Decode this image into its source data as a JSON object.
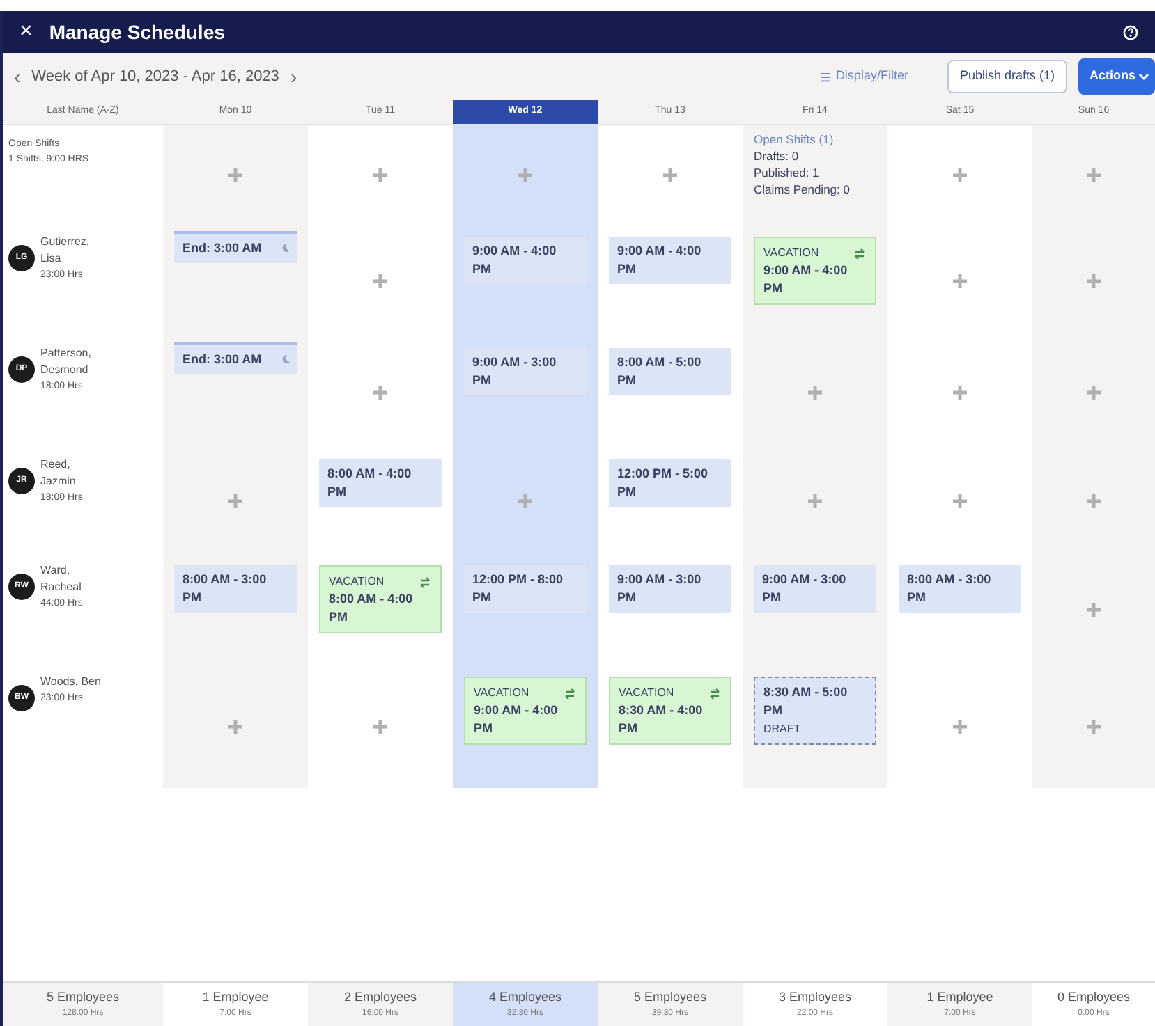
{
  "window": {
    "title": "Manage Schedules",
    "close": "×"
  },
  "toolbar": {
    "prev": "‹",
    "week": "Week of Apr 10, 2023 - Apr 16, 2023",
    "next": "›",
    "display_filter": "Display/Filter",
    "publish": "Publish drafts (1)",
    "actions": "Actions"
  },
  "name_column": "Last Name (A-Z)",
  "days": [
    {
      "label": "Mon 10",
      "selected": false
    },
    {
      "label": "Tue 11",
      "selected": false
    },
    {
      "label": "Wed 12",
      "selected": true
    },
    {
      "label": "Thu 13",
      "selected": false
    },
    {
      "label": "Fri 14",
      "selected": false
    },
    {
      "label": "Sat 15",
      "selected": false
    },
    {
      "label": "Sun 16",
      "selected": false
    }
  ],
  "open_shifts": {
    "title": "Open Shifts",
    "summary": "1 Shifts, 9:00 HRS",
    "cells": [
      {
        "kind": "add"
      },
      {
        "kind": "add"
      },
      {
        "kind": "add"
      },
      {
        "kind": "add"
      },
      {
        "kind": "summary",
        "title": "Open Shifts (1)",
        "lines": [
          "Drafts: 0",
          "Published: 1",
          "Claims Pending: 0"
        ]
      },
      {
        "kind": "add"
      },
      {
        "kind": "add"
      }
    ]
  },
  "employees": [
    {
      "initials": "LG",
      "name": "Gutierrez, Lisa",
      "hours": "23:00 Hrs",
      "cells": [
        {
          "kind": "ends",
          "time": "End: 3:00 AM"
        },
        {
          "kind": "add"
        },
        {
          "kind": "shift",
          "time": "9:00 AM - 4:00 PM"
        },
        {
          "kind": "shift",
          "time": "9:00 AM - 4:00 PM"
        },
        {
          "kind": "vacation",
          "label": "VACATION",
          "time": "9:00 AM - 4:00 PM"
        },
        {
          "kind": "add"
        },
        {
          "kind": "add"
        }
      ]
    },
    {
      "initials": "DP",
      "name": "Patterson, Desmond",
      "hours": "18:00 Hrs",
      "cells": [
        {
          "kind": "ends",
          "time": "End: 3:00 AM"
        },
        {
          "kind": "add"
        },
        {
          "kind": "shift",
          "time": "9:00 AM - 3:00 PM"
        },
        {
          "kind": "shift",
          "time": "8:00 AM - 5:00 PM"
        },
        {
          "kind": "add"
        },
        {
          "kind": "add"
        },
        {
          "kind": "add"
        }
      ]
    },
    {
      "initials": "JR",
      "name": "Reed, Jazmin",
      "hours": "18:00 Hrs",
      "cells": [
        {
          "kind": "add"
        },
        {
          "kind": "shift",
          "time": "8:00 AM - 4:00 PM"
        },
        {
          "kind": "add"
        },
        {
          "kind": "shift",
          "time": "12:00 PM - 5:00 PM"
        },
        {
          "kind": "add"
        },
        {
          "kind": "add"
        },
        {
          "kind": "add"
        }
      ]
    },
    {
      "initials": "RW",
      "name": "Ward, Racheal",
      "hours": "44:00 Hrs",
      "cells": [
        {
          "kind": "shift",
          "time": "8:00 AM - 3:00 PM"
        },
        {
          "kind": "vacation",
          "label": "VACATION",
          "time": "8:00 AM - 4:00 PM"
        },
        {
          "kind": "shift",
          "time": "12:00 PM - 8:00 PM"
        },
        {
          "kind": "shift",
          "time": "9:00 AM - 3:00 PM"
        },
        {
          "kind": "shift",
          "time": "9:00 AM - 3:00 PM"
        },
        {
          "kind": "shift",
          "time": "8:00 AM - 3:00 PM"
        },
        {
          "kind": "add"
        }
      ]
    },
    {
      "initials": "BW",
      "name": "Woods, Ben",
      "hours": "23:00 Hrs",
      "cells": [
        {
          "kind": "add"
        },
        {
          "kind": "add"
        },
        {
          "kind": "vacation",
          "label": "VACATION",
          "time": "9:00 AM - 4:00 PM"
        },
        {
          "kind": "vacation",
          "label": "VACATION",
          "time": "8:30 AM - 4:00 PM"
        },
        {
          "kind": "draft",
          "time": "8:30 AM - 5:00 PM",
          "label": "DRAFT"
        },
        {
          "kind": "add"
        },
        {
          "kind": "add"
        }
      ]
    }
  ],
  "totals": [
    {
      "count": "5 Employees",
      "hours": "128:00 Hrs",
      "selected": false
    },
    {
      "count": "1 Employee",
      "hours": "7:00 Hrs",
      "selected": false
    },
    {
      "count": "2 Employees",
      "hours": "16:00 Hrs",
      "selected": false
    },
    {
      "count": "4 Employees",
      "hours": "32:30 Hrs",
      "selected": true
    },
    {
      "count": "5 Employees",
      "hours": "39:30 Hrs",
      "selected": false
    },
    {
      "count": "3 Employees",
      "hours": "22:00 Hrs",
      "selected": false
    },
    {
      "count": "1 Employee",
      "hours": "7:00 Hrs",
      "selected": false
    },
    {
      "count": "0 Employees",
      "hours": "0:00 Hrs",
      "selected": false
    }
  ]
}
